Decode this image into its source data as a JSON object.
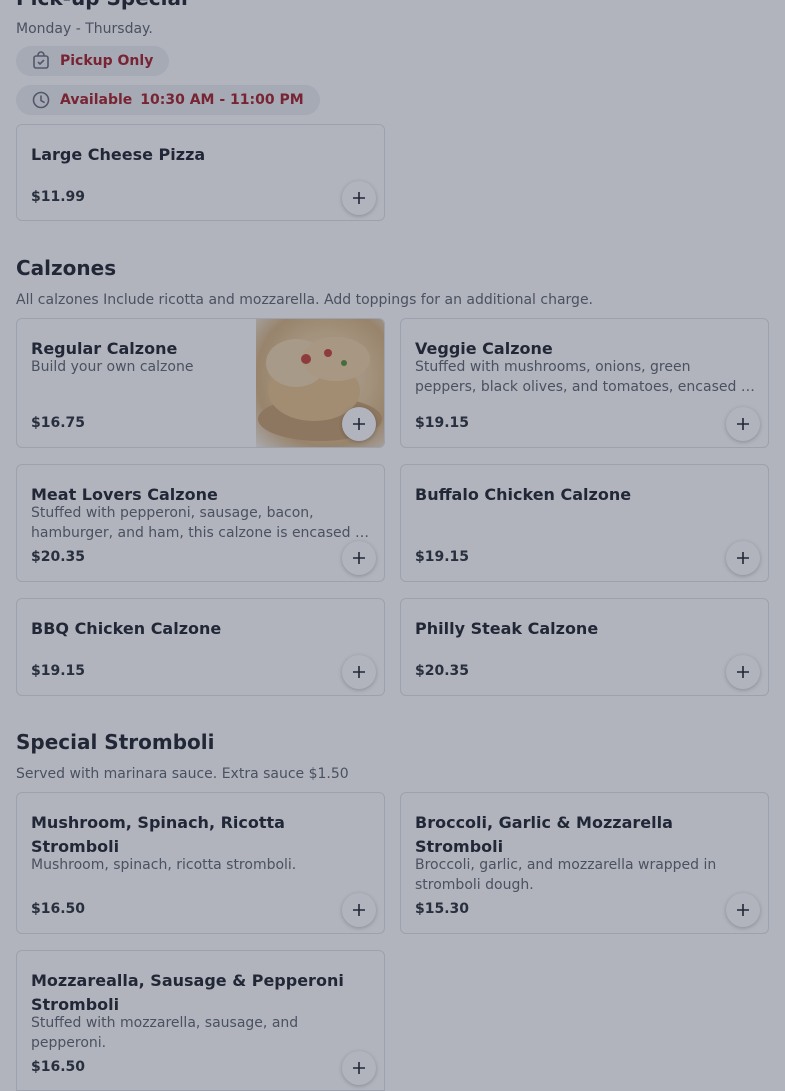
{
  "pickup": {
    "title": "Pick-up Special",
    "subtitle": "Monday - Thursday.",
    "chip_pickup": "Pickup Only",
    "chip_available_label": "Available",
    "chip_available_hours": "10:30 AM - 11:00 PM",
    "items": [
      {
        "name": "Large Cheese Pizza",
        "price": "$11.99"
      }
    ]
  },
  "calzones": {
    "title": "Calzones",
    "subtitle": "All calzones Include ricotta and mozzarella. Add toppings for an additional charge.",
    "items": [
      {
        "name": "Regular Calzone",
        "desc": "Build your own calzone",
        "price": "$16.75"
      },
      {
        "name": "Veggie Calzone",
        "desc": "Stuffed with mushrooms, onions, green peppers, black olives, and tomatoes, encased in our golden crust.",
        "price": "$19.15"
      },
      {
        "name": "Meat Lovers Calzone",
        "desc": "Stuffed with pepperoni, sausage, bacon, hamburger, and ham, this calzone is encased in our golden crust.",
        "price": "$20.35"
      },
      {
        "name": "Buffalo Chicken Calzone",
        "price": "$19.15"
      },
      {
        "name": "BBQ Chicken Calzone",
        "price": "$19.15"
      },
      {
        "name": "Philly Steak Calzone",
        "price": "$20.35"
      }
    ]
  },
  "stromboli": {
    "title": "Special Stromboli",
    "subtitle": "Served with marinara sauce. Extra sauce $1.50",
    "items": [
      {
        "name": "Mushroom, Spinach, Ricotta Stromboli",
        "desc": "Mushroom, spinach, ricotta stromboli.",
        "price": "$16.50"
      },
      {
        "name": "Broccoli, Garlic & Mozzarella Stromboli",
        "desc": "Broccoli, garlic, and mozzarella wrapped in stromboli dough.",
        "price": "$15.30"
      },
      {
        "name": "Mozzarealla, Sausage & Pepperoni Stromboli",
        "desc": "Stuffed with mozzarella, sausage, and pepperoni.",
        "price": "$16.50"
      }
    ]
  },
  "colors": {
    "accent": "#a61e2a",
    "overlay": "#282e46"
  },
  "icons": {
    "pickup": "bag-icon",
    "available": "clock-icon",
    "add": "plus-icon"
  }
}
